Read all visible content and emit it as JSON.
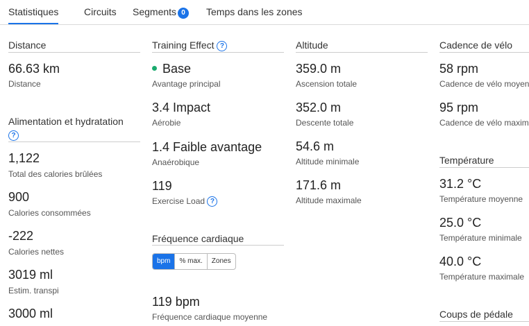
{
  "tabs": [
    {
      "label": "Statistiques"
    },
    {
      "label": "Circuits"
    },
    {
      "label": "Segments",
      "badge": "0"
    },
    {
      "label": "Temps dans les zones"
    }
  ],
  "distance": {
    "title": "Distance",
    "items": [
      {
        "value": "66.63 km",
        "label": "Distance"
      }
    ]
  },
  "nutrition": {
    "title": "Alimentation et hydratation",
    "items": [
      {
        "value": "1,122",
        "label": "Total des calories brûlées"
      },
      {
        "value": "900",
        "label": "Calories consommées"
      },
      {
        "value": "-222",
        "label": "Calories nettes"
      },
      {
        "value": "3019 ml",
        "label": "Estim. transpi"
      },
      {
        "value": "3000 ml",
        "label": ""
      }
    ]
  },
  "training": {
    "title": "Training Effect",
    "items": [
      {
        "value": "Base",
        "label": "Avantage principal"
      },
      {
        "value": "3.4 Impact",
        "label": "Aérobie"
      },
      {
        "value": "1.4 Faible avantage",
        "label": "Anaérobique"
      },
      {
        "value": "119",
        "label": "Exercise Load"
      }
    ]
  },
  "heart": {
    "title": "Fréquence cardiaque",
    "toggle": [
      "bpm",
      "% max.",
      "Zones"
    ],
    "items": [
      {
        "value": "119 bpm",
        "label": "Fréquence cardiaque moyenne"
      }
    ]
  },
  "altitude": {
    "title": "Altitude",
    "items": [
      {
        "value": "359.0 m",
        "label": "Ascension totale"
      },
      {
        "value": "352.0 m",
        "label": "Descente totale"
      },
      {
        "value": "54.6 m",
        "label": "Altitude minimale"
      },
      {
        "value": "171.6 m",
        "label": "Altitude maximale"
      }
    ]
  },
  "cadence": {
    "title": "Cadence de vélo",
    "items": [
      {
        "value": "58 rpm",
        "label": "Cadence de vélo moyenne"
      },
      {
        "value": "95 rpm",
        "label": "Cadence de vélo maximale"
      }
    ]
  },
  "temperature": {
    "title": "Température",
    "items": [
      {
        "value": "31.2 °C",
        "label": "Température moyenne"
      },
      {
        "value": "25.0 °C",
        "label": "Température minimale"
      },
      {
        "value": "40.0 °C",
        "label": "Température maximale"
      }
    ]
  },
  "pedal": {
    "title": "Coups de pédale"
  }
}
